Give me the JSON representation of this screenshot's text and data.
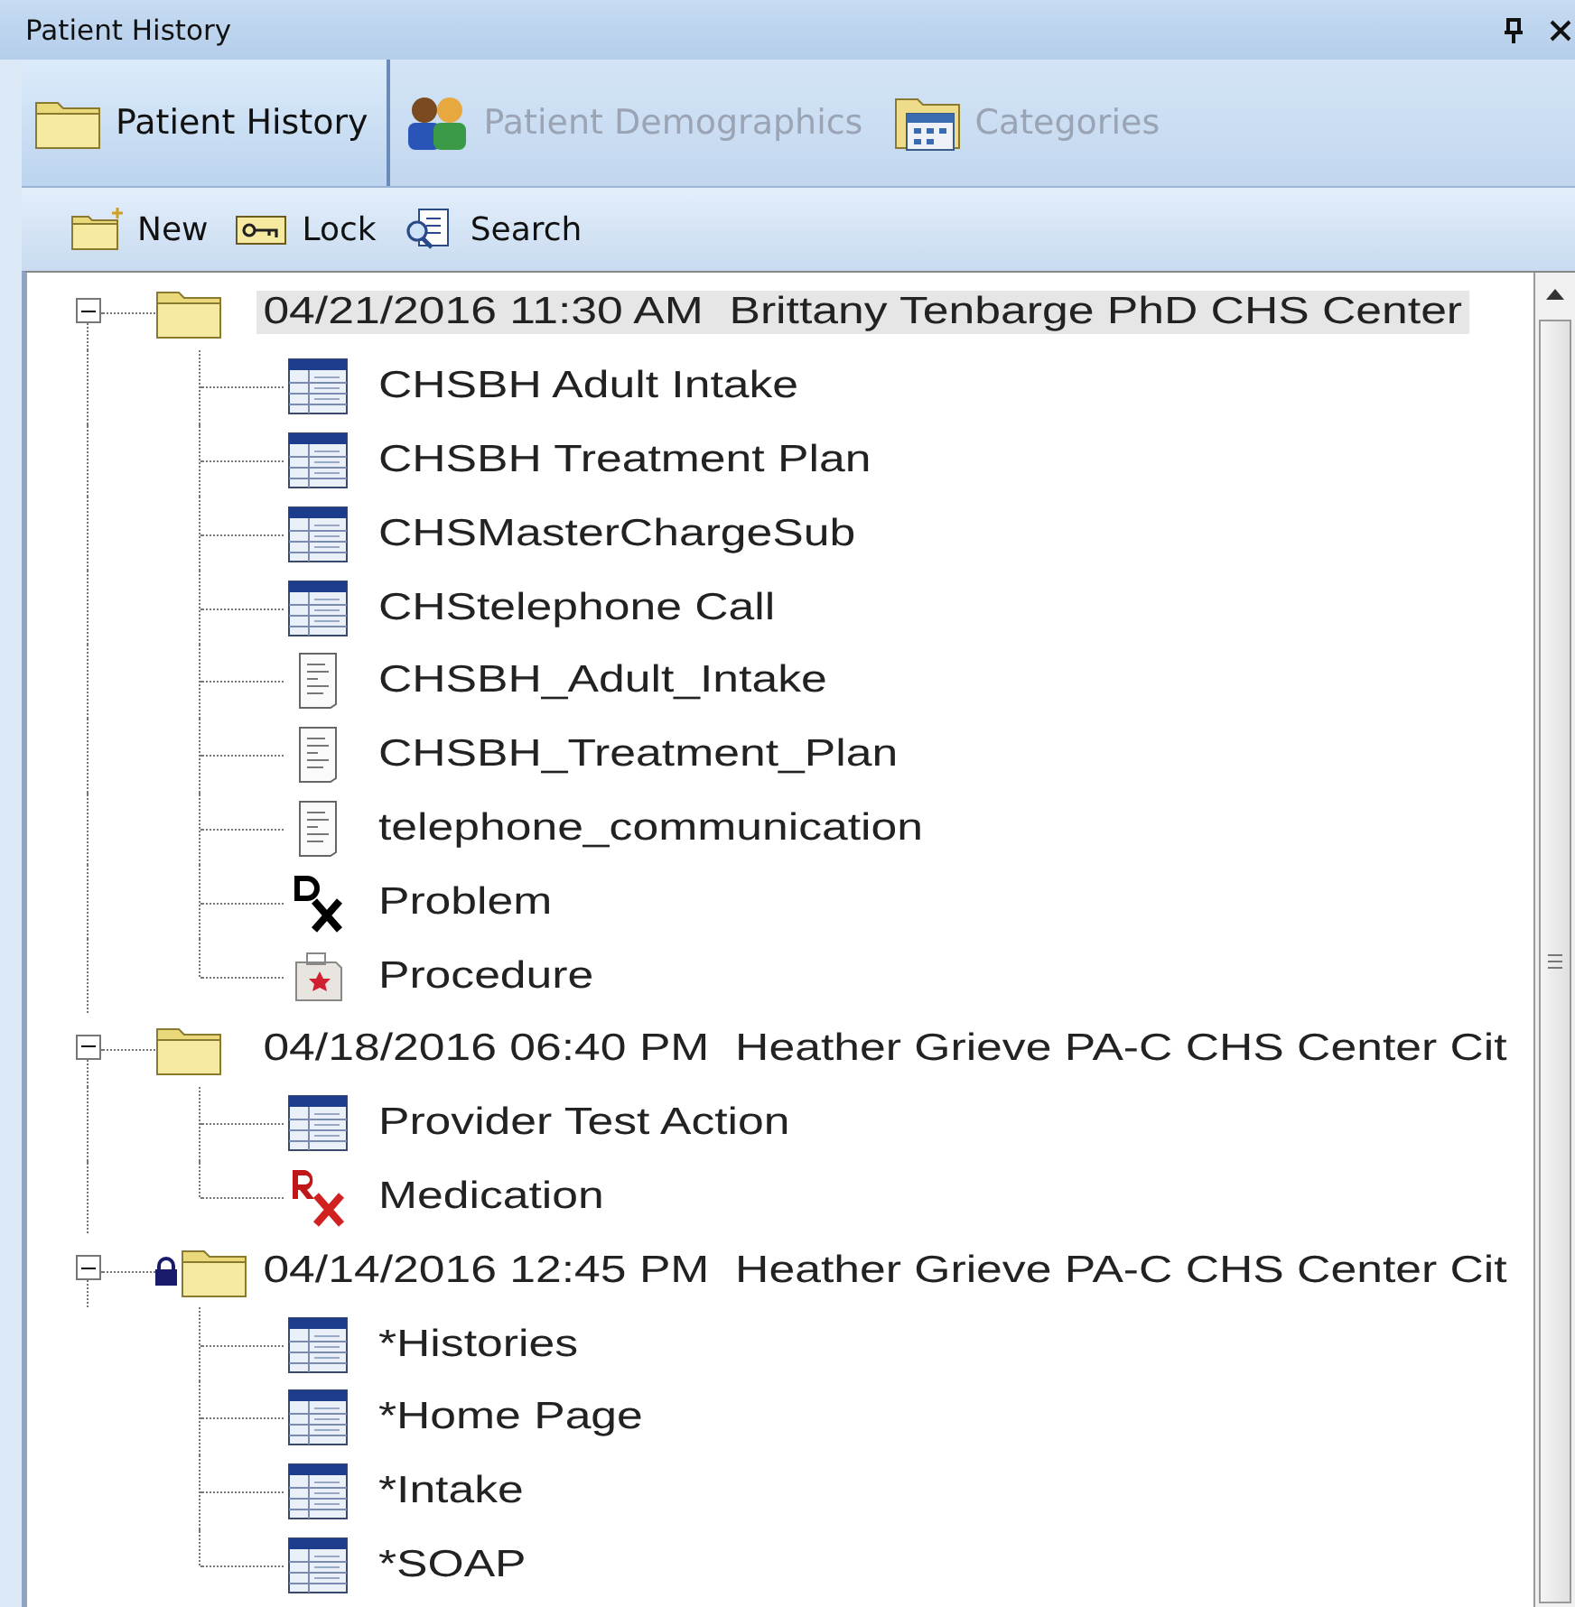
{
  "panel": {
    "title": "Patient History"
  },
  "tabs": [
    {
      "label": "Patient History",
      "selected": true
    },
    {
      "label": "Patient Demographics",
      "selected": false
    },
    {
      "label": "Categories",
      "selected": false
    }
  ],
  "toolbar": [
    {
      "label": "New"
    },
    {
      "label": "Lock"
    },
    {
      "label": "Search"
    }
  ],
  "tree": [
    {
      "label": "04/21/2016 11:30 AM  Brittany Tenbarge PhD CHS Center",
      "expanded": true,
      "locked": false,
      "selected": true,
      "children": [
        {
          "label": "CHSBH Adult Intake",
          "kind": "form",
          "selected": false
        },
        {
          "label": "CHSBH Treatment Plan",
          "kind": "form",
          "selected": false
        },
        {
          "label": "CHSMasterChargeSub",
          "kind": "form",
          "selected": false
        },
        {
          "label": "CHStelephone Call",
          "kind": "form",
          "selected": false
        },
        {
          "label": "CHSBH_Adult_Intake",
          "kind": "document",
          "selected": false
        },
        {
          "label": "CHSBH_Treatment_Plan",
          "kind": "document",
          "selected": false
        },
        {
          "label": "telephone_communication",
          "kind": "document",
          "selected": false
        },
        {
          "label": "Problem",
          "kind": "problem",
          "selected": false
        },
        {
          "label": "Procedure",
          "kind": "procedure",
          "selected": false
        }
      ]
    },
    {
      "label": "04/18/2016 06:40 PM  Heather Grieve PA-C CHS Center Cit",
      "expanded": true,
      "locked": false,
      "selected": false,
      "children": [
        {
          "label": "Provider Test Action",
          "kind": "form",
          "selected": false
        },
        {
          "label": "Medication",
          "kind": "medication",
          "selected": false
        }
      ]
    },
    {
      "label": "04/14/2016 12:45 PM  Heather Grieve PA-C CHS Center Cit",
      "expanded": true,
      "locked": true,
      "selected": false,
      "children": [
        {
          "label": "*Histories",
          "kind": "form",
          "selected": false
        },
        {
          "label": "*Home Page",
          "kind": "form",
          "selected": false
        },
        {
          "label": "*Intake",
          "kind": "form",
          "selected": false
        },
        {
          "label": "*SOAP",
          "kind": "form",
          "selected": false
        }
      ]
    }
  ]
}
